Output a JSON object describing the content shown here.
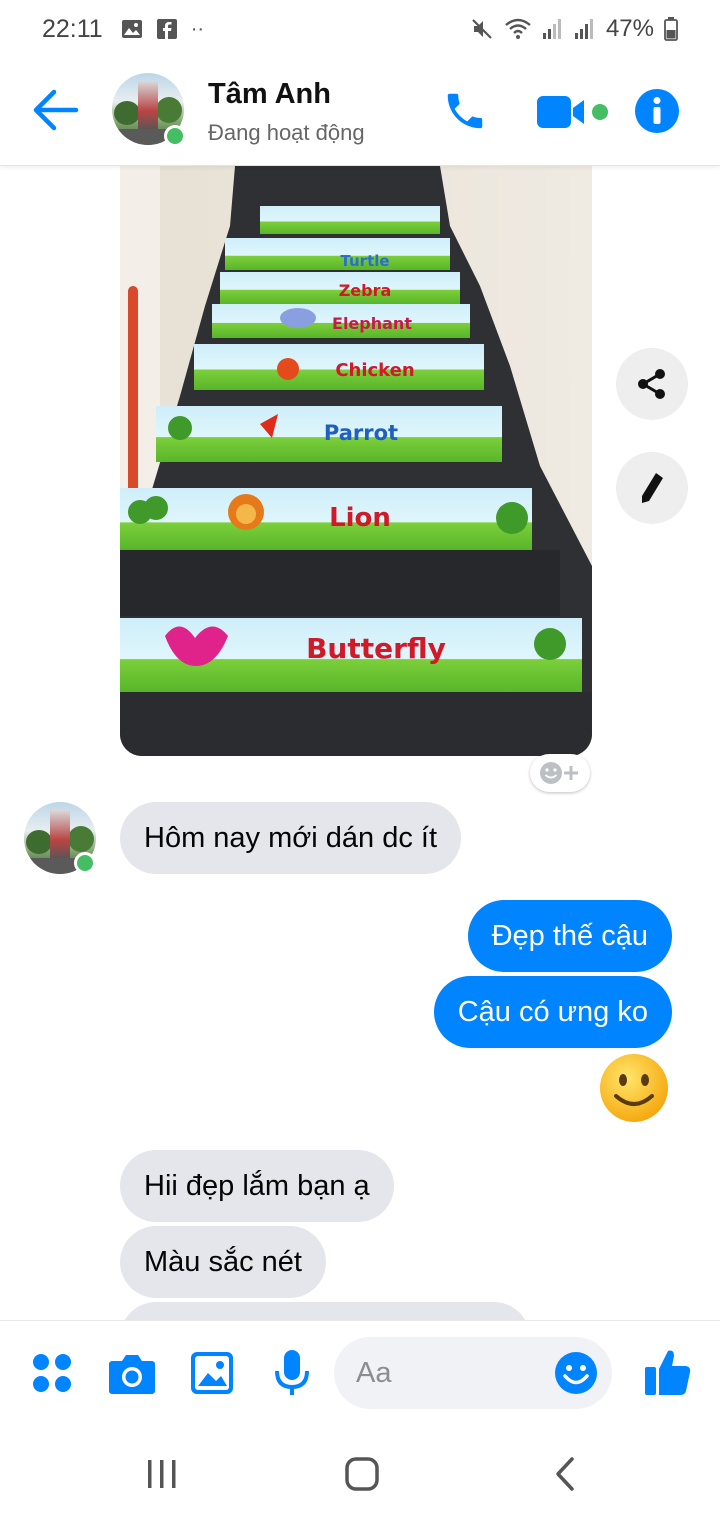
{
  "status_bar": {
    "time": "22:11",
    "battery": "47%",
    "icons_left": [
      "image-icon",
      "facebook-icon",
      "more-dots-icon"
    ],
    "icons_right": [
      "mute-icon",
      "wifi-icon",
      "signal-icon",
      "signal-icon",
      "battery-icon"
    ]
  },
  "header": {
    "contact_name": "Tâm Anh",
    "contact_status": "Đang hoạt động",
    "accent": "#0084ff",
    "online_color": "#45bd62"
  },
  "photo": {
    "stair_labels": [
      "Turtle",
      "Zebra",
      "Elephant",
      "Chicken",
      "Parrot",
      "Lion",
      "Butterfly"
    ]
  },
  "messages": [
    {
      "side": "in",
      "text": "Hôm nay mới dán dc ít"
    },
    {
      "side": "out",
      "text": "Đẹp thế cậu"
    },
    {
      "side": "out",
      "text": "Cậu có ưng ko"
    },
    {
      "side": "out",
      "text": "🙂"
    },
    {
      "side": "in",
      "text": "Hii đẹp lắm bạn ạ"
    },
    {
      "side": "in",
      "text": "Màu sắc nét"
    }
  ],
  "composer": {
    "placeholder": "Aa"
  }
}
